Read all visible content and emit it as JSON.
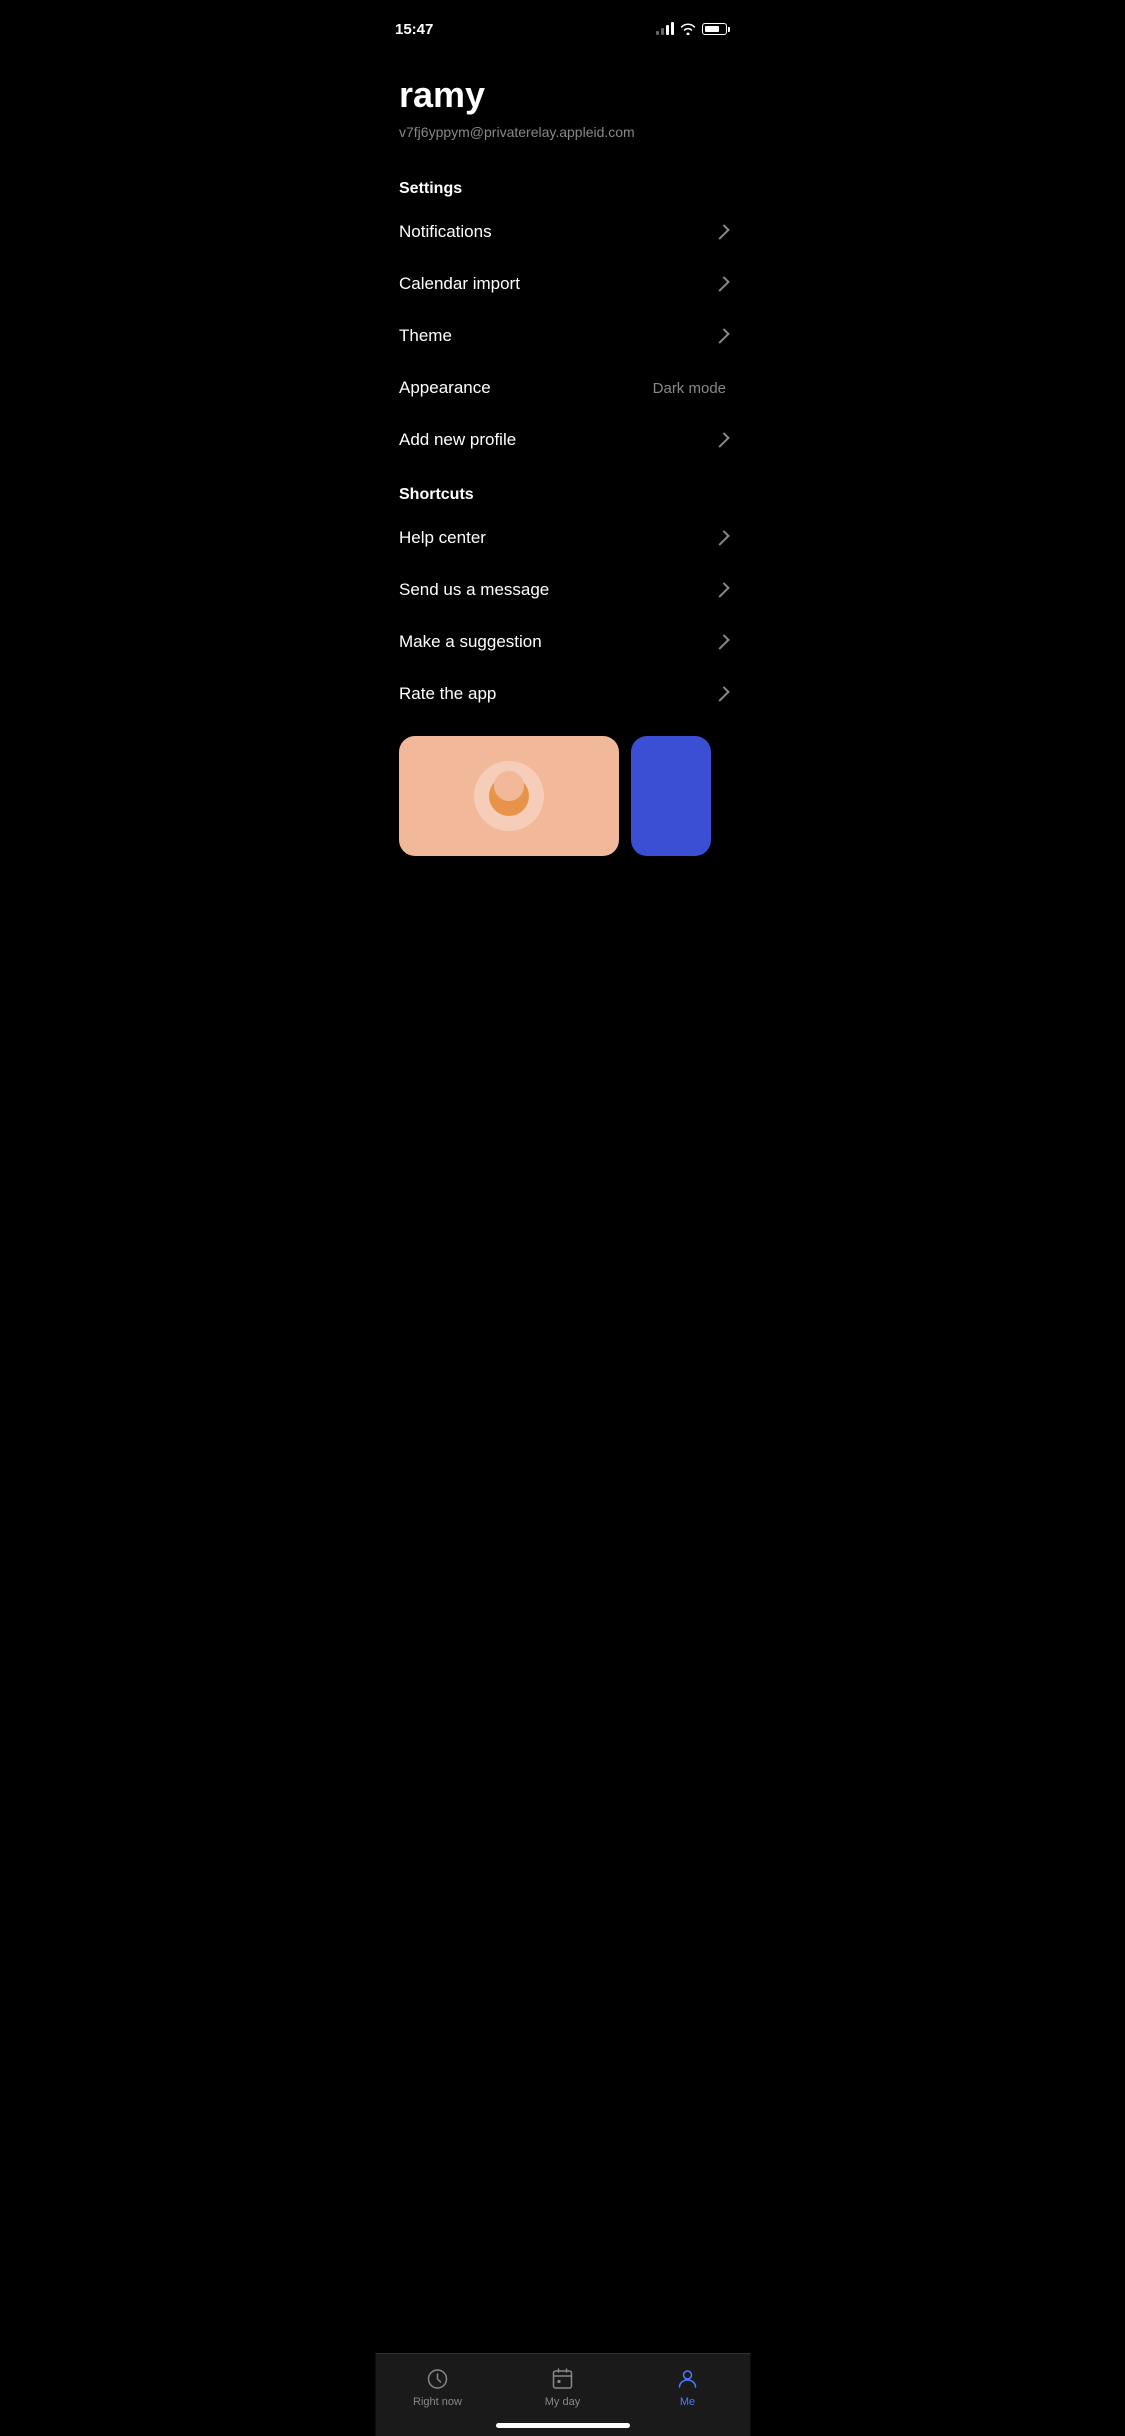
{
  "statusBar": {
    "time": "15:47"
  },
  "profile": {
    "name": "ramy",
    "email": "v7fj6yppym@privaterelay.appleid.com"
  },
  "settings": {
    "sectionLabel": "Settings",
    "items": [
      {
        "label": "Notifications",
        "value": "",
        "hasChevron": true
      },
      {
        "label": "Calendar import",
        "value": "",
        "hasChevron": true
      },
      {
        "label": "Theme",
        "value": "",
        "hasChevron": true
      },
      {
        "label": "Appearance",
        "value": "Dark mode",
        "hasChevron": false
      },
      {
        "label": "Add new profile",
        "value": "",
        "hasChevron": true
      }
    ]
  },
  "shortcuts": {
    "sectionLabel": "Shortcuts",
    "items": [
      {
        "label": "Help center",
        "value": "",
        "hasChevron": true
      },
      {
        "label": "Send us a message",
        "value": "",
        "hasChevron": true
      },
      {
        "label": "Make a suggestion",
        "value": "",
        "hasChevron": true
      },
      {
        "label": "Rate the app",
        "value": "",
        "hasChevron": true
      }
    ]
  },
  "bottomNav": {
    "items": [
      {
        "id": "right-now",
        "label": "Right now",
        "active": false
      },
      {
        "id": "my-day",
        "label": "My day",
        "active": false
      },
      {
        "id": "me",
        "label": "Me",
        "active": true
      }
    ]
  }
}
